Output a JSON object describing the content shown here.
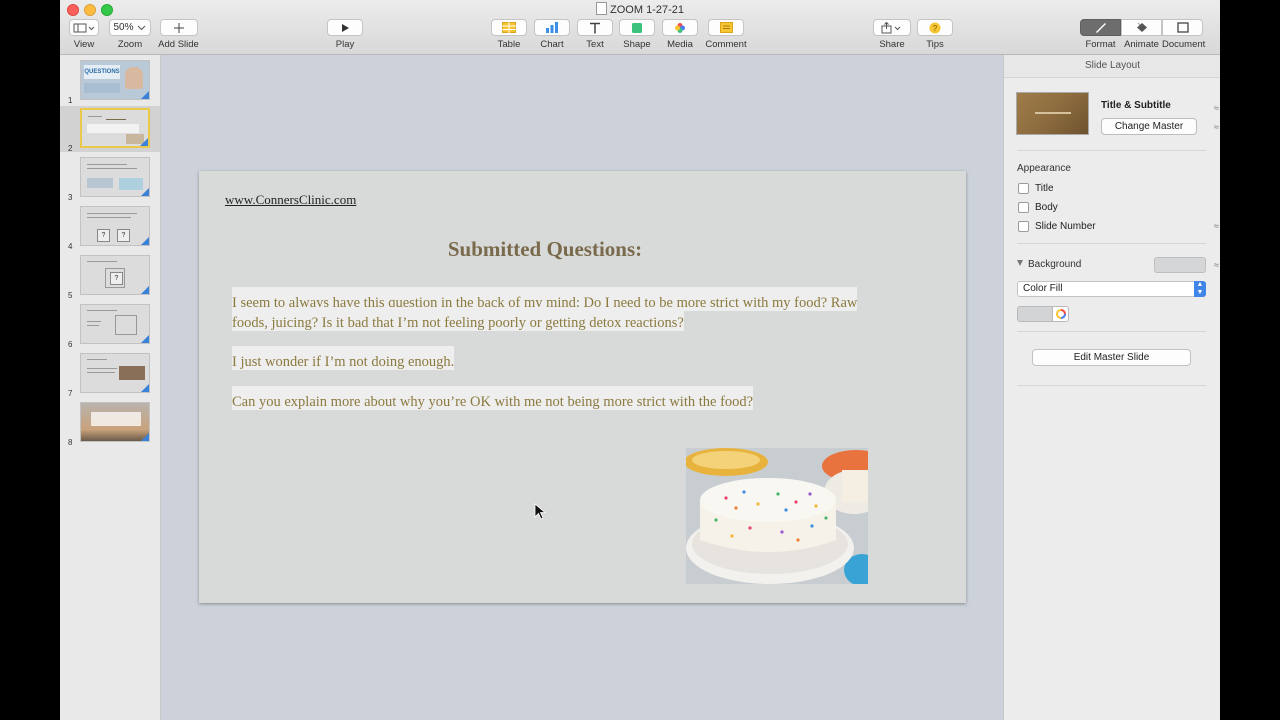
{
  "window": {
    "title": "ZOOM 1-27-21"
  },
  "toolbar": {
    "view": "View",
    "zoom": "Zoom",
    "zoom_value": "50%",
    "add_slide": "Add Slide",
    "play": "Play",
    "table": "Table",
    "chart": "Chart",
    "text": "Text",
    "shape": "Shape",
    "media": "Media",
    "comment": "Comment",
    "share": "Share",
    "tips": "Tips",
    "format": "Format",
    "animate": "Animate",
    "document": "Document"
  },
  "navigator": {
    "slides": [
      "1",
      "2",
      "3",
      "4",
      "5",
      "6",
      "7",
      "8"
    ],
    "selected": "2",
    "thumb1_text": "QUESTIONS"
  },
  "slide": {
    "link": "www.ConnersClinic.com",
    "title": "Submitted Questions:",
    "q1": "I seem to always have this question in the back of my mind: Do I need to be more strict with my food?  Raw foods, juicing?  Is it bad that I’m not feeling poorly or getting detox reactions?",
    "q2": "I just wonder if I’m not doing enough.",
    "q3": "Can you explain more about why you’re OK with me not being more strict with the food?"
  },
  "inspector": {
    "header": "Slide Layout",
    "layout_name": "Title & Subtitle",
    "change_master": "Change Master",
    "appearance": "Appearance",
    "title_cb": "Title",
    "body_cb": "Body",
    "slide_number_cb": "Slide Number",
    "background": "Background",
    "fill_type": "Color Fill",
    "edit_master": "Edit Master Slide"
  },
  "colors": {
    "accent": "#3f86e8",
    "slide_background": "#d8d9d9",
    "title_color": "#7a6a4c",
    "body_color": "#8b7a3e"
  }
}
